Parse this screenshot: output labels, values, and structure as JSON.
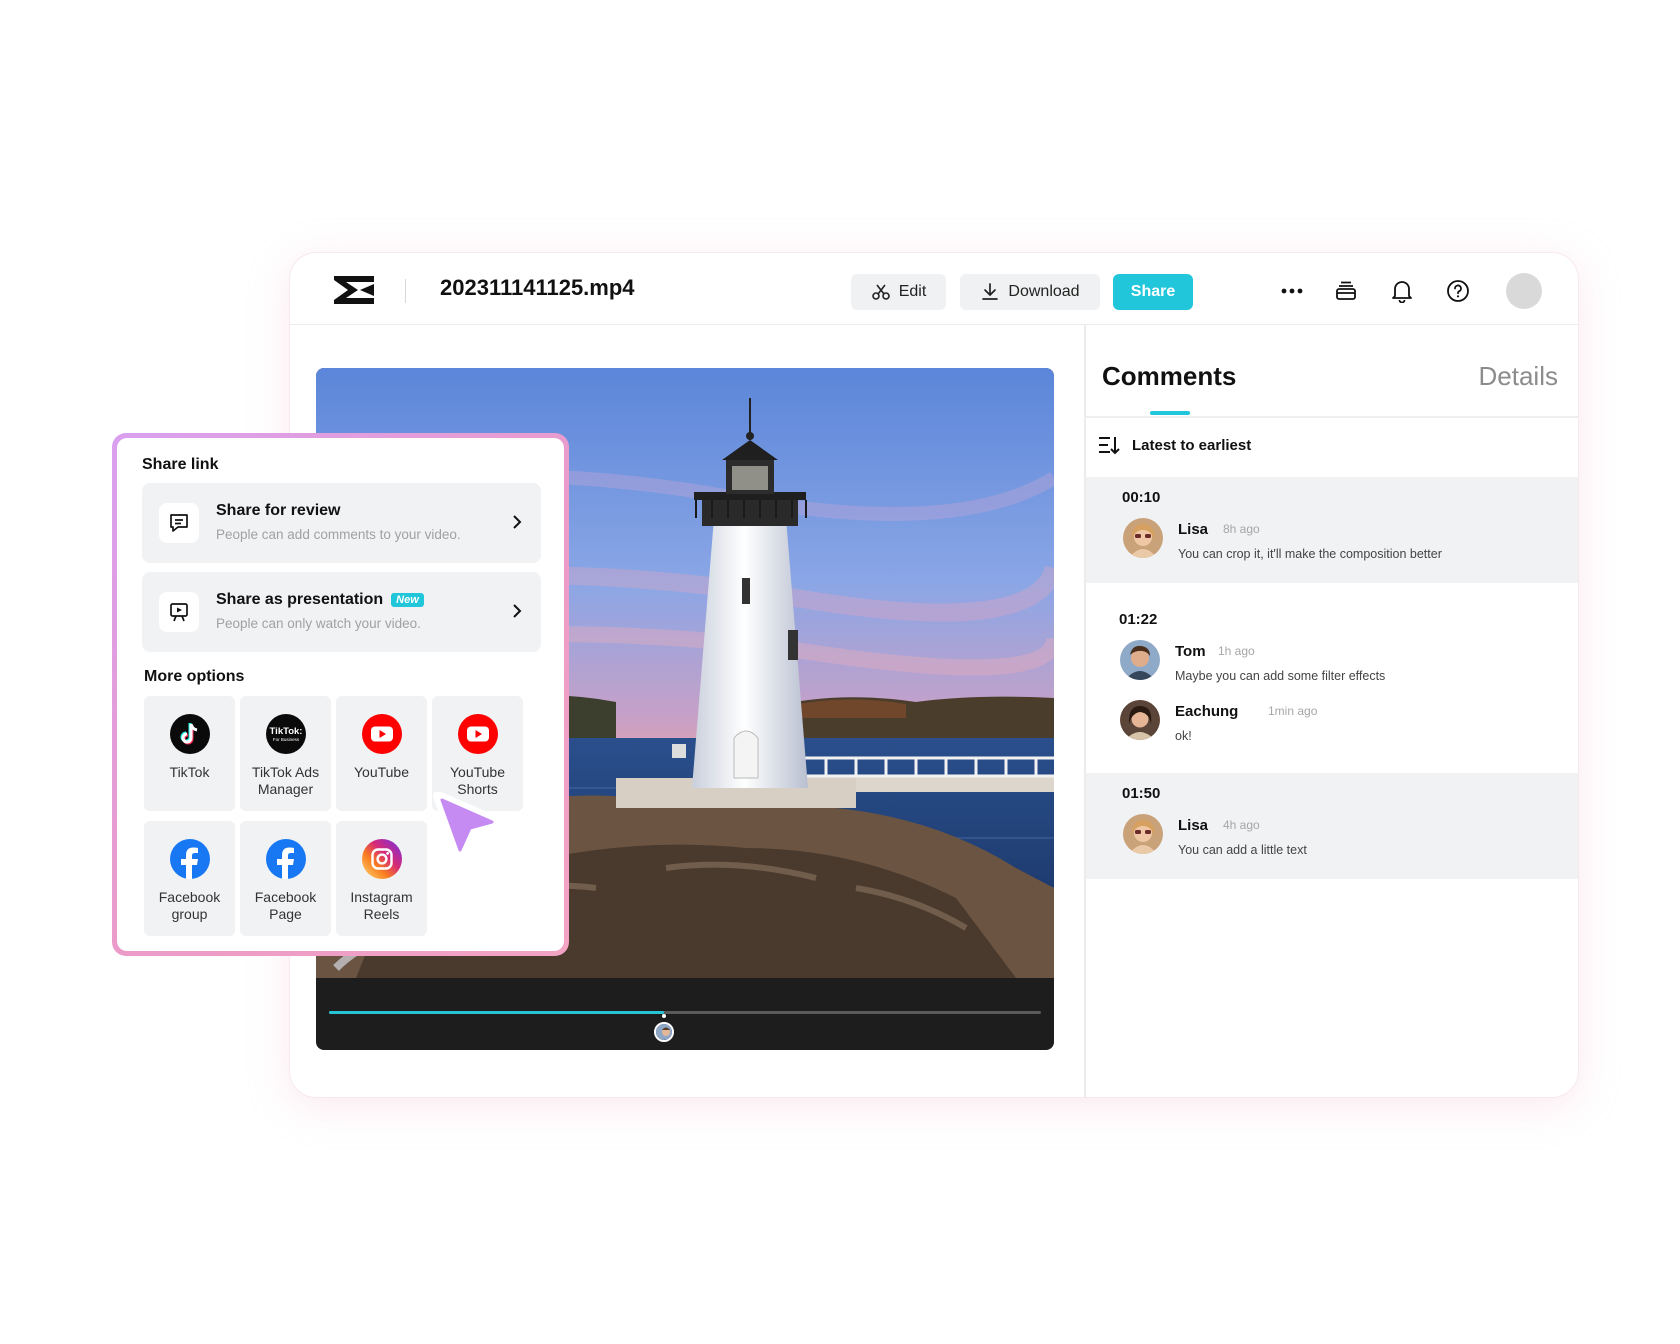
{
  "header": {
    "file_name": "202311141125.mp4",
    "edit_label": "Edit",
    "download_label": "Download",
    "share_label": "Share"
  },
  "player": {
    "progress_fraction": 0.47
  },
  "panel": {
    "tabs": [
      {
        "label": "Comments",
        "active": true
      },
      {
        "label": "Details",
        "active": false
      }
    ],
    "sort_label": "Latest to earliest",
    "groups": [
      {
        "timestamp": "00:10",
        "comments": [
          {
            "name": "Lisa",
            "time": "8h ago",
            "text": "You can crop it, it'll make the composition better"
          }
        ]
      },
      {
        "timestamp": "01:22",
        "comments": [
          {
            "name": "Tom",
            "time": "1h ago",
            "text": "Maybe you can add some filter effects"
          },
          {
            "name": "Eachung",
            "time": "1min ago",
            "text": "ok!"
          }
        ]
      },
      {
        "timestamp": "01:50",
        "comments": [
          {
            "name": "Lisa",
            "time": "4h ago",
            "text": "You can add a little text"
          }
        ]
      }
    ]
  },
  "share_popup": {
    "heading": "Share link",
    "review": {
      "title": "Share for review",
      "subtitle": "People can add comments to your video."
    },
    "presentation": {
      "title": "Share as presentation",
      "badge": "New",
      "subtitle": "People can only watch your video."
    },
    "more_heading": "More options",
    "options": [
      {
        "label_line1": "TikTok",
        "label_line2": "",
        "icon": "tiktok-icon"
      },
      {
        "label_line1": "TikTok Ads",
        "label_line2": "Manager",
        "icon": "tiktok-for-business-icon",
        "icon_text_1": "TikTok:",
        "icon_text_2": "For Business"
      },
      {
        "label_line1": "YouTube",
        "label_line2": "",
        "icon": "youtube-icon"
      },
      {
        "label_line1": "YouTube",
        "label_line2": "Shorts",
        "icon": "youtube-icon"
      },
      {
        "label_line1": "Facebook",
        "label_line2": "group",
        "icon": "facebook-icon"
      },
      {
        "label_line1": "Facebook",
        "label_line2": "Page",
        "icon": "facebook-icon"
      },
      {
        "label_line1": "Instagram",
        "label_line2": "Reels",
        "icon": "instagram-icon"
      }
    ]
  },
  "colors": {
    "accent": "#21c6db",
    "youtube_red": "#ff0000",
    "facebook_blue": "#1877f2",
    "popup_border": "#e89ad0"
  }
}
